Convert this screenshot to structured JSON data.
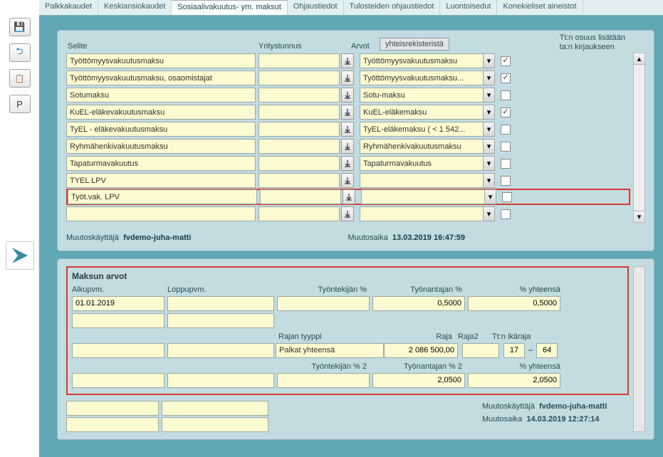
{
  "sidebar": {
    "btn_save": "💾",
    "btn_back": "⬅",
    "btn_doc": "📄",
    "btn_p": "P"
  },
  "tabs": [
    "Palkkakaudet",
    "Keskiansiokaudet",
    "Sosiaalivakuutus- ym. maksut",
    "Ohjaustiedot",
    "Tulosteiden ohjaustiedot",
    "Luontoisedut",
    "Konekieliset aineistot"
  ],
  "active_tab_index": 2,
  "top": {
    "col_selite": "Selite",
    "col_yritys": "Yritystunnus",
    "col_arvot": "Arvot",
    "btn_yht": "yhteisrekisteristä",
    "right_top": "Tt:n osuus lisätään",
    "right_bot": "ta:n kirjaukseen",
    "rows": [
      {
        "selite": "Työttömyysvakuutusmaksu",
        "select": "Työttömyysvakuutusmaksu",
        "checked": true
      },
      {
        "selite": "Työttömyysvakuutusmaksu, osaomistajat",
        "select": "Työttömyysvakuutusmaksu...",
        "checked": true
      },
      {
        "selite": "Sotumaksu",
        "select": "Sotu-maksu",
        "checked": false
      },
      {
        "selite": "KuEL-eläkevakuutusmaksu",
        "select": "KuEL-eläkemaksu",
        "checked": true
      },
      {
        "selite": "TyEL - eläkevakuutusmaksu",
        "select": "TyEL-eläkemaksu ( < 1 542...",
        "checked": false
      },
      {
        "selite": "Ryhmähenkivakuutusmaksu",
        "select": "Ryhmähenkivakuutusmaksu",
        "checked": false
      },
      {
        "selite": "Tapaturmavakuutus",
        "select": "Tapaturmavakuutus",
        "checked": false
      },
      {
        "selite": "TYEL LPV",
        "select": "",
        "checked": false
      },
      {
        "selite": "Työt.vak. LPV",
        "select": "",
        "checked": false,
        "highlight": true
      },
      {
        "selite": "",
        "select": "",
        "checked": false
      }
    ],
    "muutoskayttaja_label": "Muutoskäyttäjä",
    "muutoskayttaja": "fvdemo-juha-matti",
    "muutosaika_label": "Muutosaika",
    "muutosaika": "13.03.2019 16:47:59"
  },
  "bottom": {
    "title": "Maksun arvot",
    "hdr_alku": "Alkupvm.",
    "hdr_loppu": "Loppupvm.",
    "hdr_tyon": "Työntekijän %",
    "hdr_tyona": "Työnantajan %",
    "hdr_yht": "% yhteensä",
    "row1": {
      "alku": "01.01.2019",
      "loppu": "",
      "tyon": "",
      "tyona": "0,5000",
      "yht": "0,5000"
    },
    "hdr_rajan": "Rajan tyyppi",
    "hdr_raja": "Raja",
    "hdr_raja2": "Raja2",
    "hdr_ika": "Tt:n ikäraja",
    "row2": {
      "rajan": "Palkat yhteensä",
      "raja": "2 086 500,00",
      "raja2": "",
      "ika1": "17",
      "ika2": "64"
    },
    "hdr_tyon2": "Työntekijän % 2",
    "hdr_tyona2": "Työnantajan % 2",
    "hdr_yht2": "% yhteensä",
    "row3": {
      "tyon": "",
      "tyona": "2,0500",
      "yht": "2,0500"
    },
    "muutoskayttaja_label": "Muutoskäyttäjä",
    "muutoskayttaja": "fvdemo-juha-matti",
    "muutosaika_label": "Muutosaika",
    "muutosaika": "14.03.2019 12:27:14"
  }
}
